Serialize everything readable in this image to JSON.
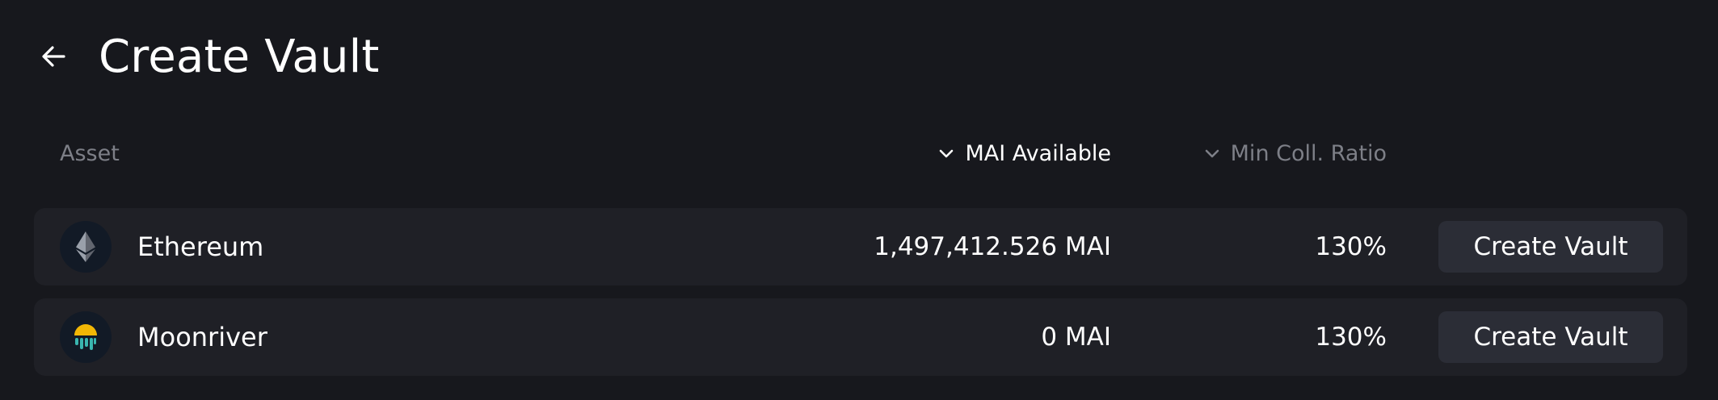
{
  "header": {
    "title": "Create Vault",
    "back_icon": "arrow-left-icon"
  },
  "table": {
    "columns": {
      "asset": "Asset",
      "mai_available": "MAI Available",
      "min_coll_ratio": "Min Coll. Ratio"
    },
    "sort_icon": "chevron-down-icon",
    "rows": [
      {
        "asset": "Ethereum",
        "icon": "ethereum-icon",
        "mai_available": "1,497,412.526 MAI",
        "min_coll_ratio": "130%",
        "action_label": "Create Vault"
      },
      {
        "asset": "Moonriver",
        "icon": "moonriver-icon",
        "mai_available": "0 MAI",
        "min_coll_ratio": "130%",
        "action_label": "Create Vault"
      }
    ]
  },
  "colors": {
    "background": "#17181d",
    "row_background": "#1f2026",
    "button_background": "#2b2d36",
    "muted_text": "#7d7f87",
    "moonriver_yellow": "#f2b705",
    "moonriver_teal": "#3ab6b0"
  }
}
